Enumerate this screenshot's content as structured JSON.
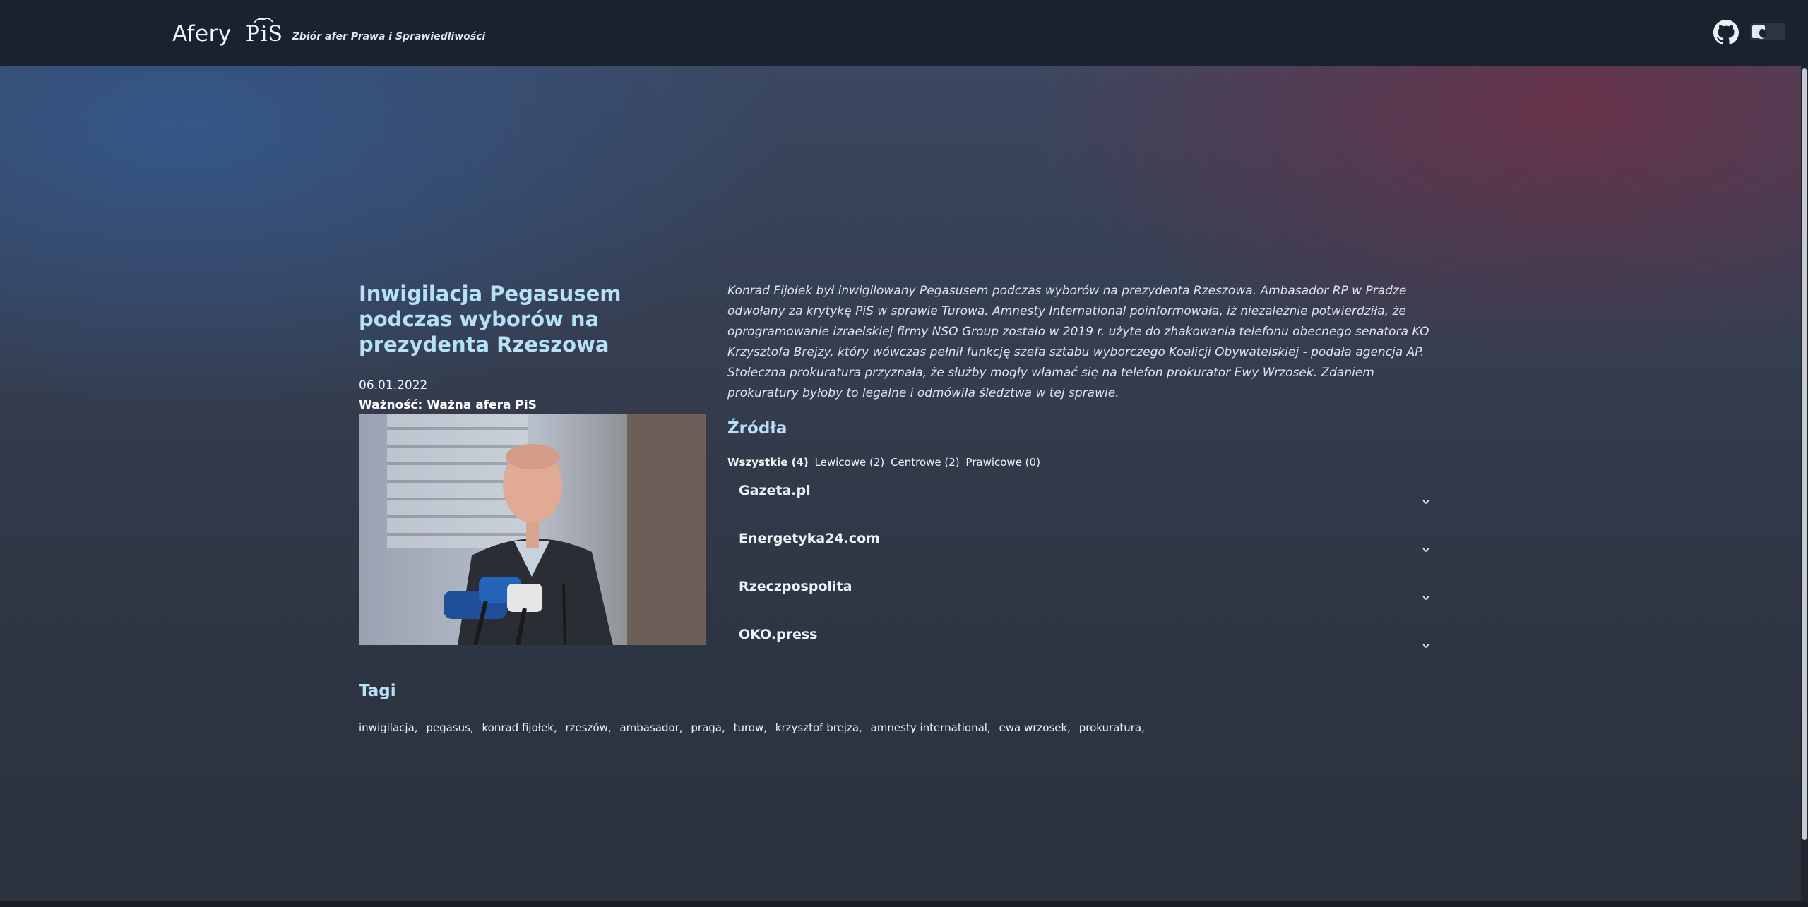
{
  "header": {
    "brand": "Afery",
    "logo_text": "PiS",
    "tagline": "Zbiór afer Prawa i Sprawiedliwości",
    "github_icon": "github-icon",
    "theme_toggle_icon": "moon-icon"
  },
  "article": {
    "title": "Inwigilacja Pegasusem podczas wyborów na prezydenta Rzeszowa",
    "date": "06.01.2022",
    "importance": "Ważność: Ważna afera PiS",
    "description": "Konrad Fijołek był inwigilowany Pegasusem podczas wyborów na prezydenta Rzeszowa. Ambasador RP w Pradze odwołany za krytykę PiS w sprawie Turowa. Amnesty International poinformowała, iż niezależnie potwierdziła, że oprogramowanie izraelskiej firmy NSO Group zostało w 2019 r. użyte do zhakowania telefonu obecnego senatora KO Krzysztofa Brejzy, który wówczas pełnił funkcję szefa sztabu wyborczego Koalicji Obywatelskiej - podała agencja AP. Stołeczna prokuratura przyznała, że służby mogły włamać się na telefon prokurator Ewy Wrzosek. Zdaniem prokuratury byłoby to legalne i odmówiła śledztwa w tej sprawie."
  },
  "sources": {
    "heading": "Źródła",
    "filters": [
      "Wszystkie (4)",
      "Lewicowe (2)",
      "Centrowe (2)",
      "Prawicowe (0)"
    ],
    "active_filter": "Wszystkie (4)",
    "items": [
      "Gazeta.pl",
      "Energetyka24.com",
      "Rzeczpospolita",
      "OKO.press"
    ]
  },
  "tags": {
    "heading": "Tagi",
    "items": [
      "inwigilacja,",
      "pegasus,",
      "konrad fijołek,",
      "rzeszów,",
      "ambasador,",
      "praga,",
      "turow,",
      "krzysztof brejza,",
      "amnesty international,",
      "ewa wrzosek,",
      "prokuratura,"
    ]
  },
  "colors": {
    "heading": "#b6e0f5",
    "topbar": "#1a2230",
    "background": "#2b323e"
  }
}
